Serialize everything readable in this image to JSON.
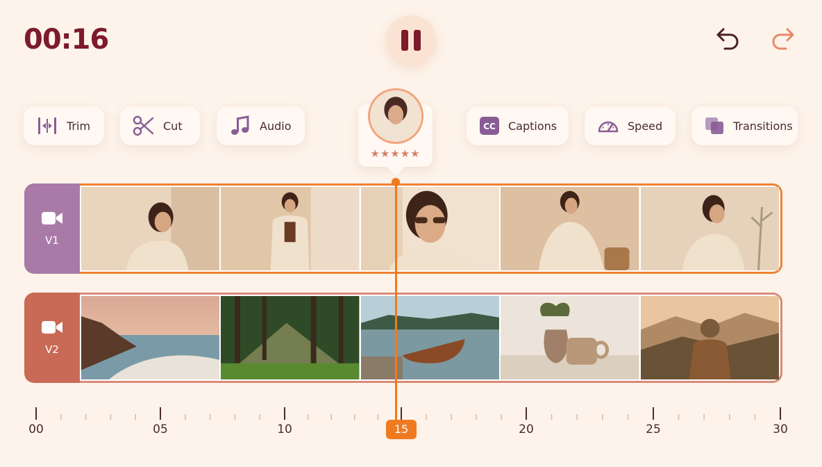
{
  "playback": {
    "current_time": "00:16",
    "playhead_label": "15"
  },
  "header": {
    "pause_icon": "pause-icon",
    "undo_icon": "undo-icon",
    "redo_icon": "redo-icon"
  },
  "tools": [
    {
      "label": "Trim",
      "icon": "trim-icon"
    },
    {
      "label": "Cut",
      "icon": "scissors-icon"
    },
    {
      "label": "Audio",
      "icon": "music-note-icon"
    },
    {
      "label": "Captions",
      "icon": "captions-icon"
    },
    {
      "label": "Speed",
      "icon": "speedometer-icon"
    },
    {
      "label": "Transitions",
      "icon": "transitions-icon"
    }
  ],
  "clip_preview": {
    "rating_stars": 5,
    "rating_text": "★★★★★"
  },
  "tracks": [
    {
      "name": "V1",
      "icon": "video-camera-icon",
      "color": "#a97aa8",
      "selected": true,
      "frames": [
        "woman-portrait-hand-chin",
        "woman-standing-blazer",
        "woman-sunglasses",
        "woman-sitting-chair",
        "woman-profile-plant"
      ]
    },
    {
      "name": "V2",
      "icon": "video-camera-icon",
      "color": "#c86a55",
      "selected": false,
      "frames": [
        "coastline-sunset",
        "forest-sunrays",
        "lake-boat",
        "vase-and-cup",
        "hiker-mountains"
      ]
    }
  ],
  "timeline": {
    "labels": [
      "00",
      "05",
      "10",
      "15",
      "20",
      "25",
      "30"
    ],
    "accent_color": "#f07a20"
  }
}
